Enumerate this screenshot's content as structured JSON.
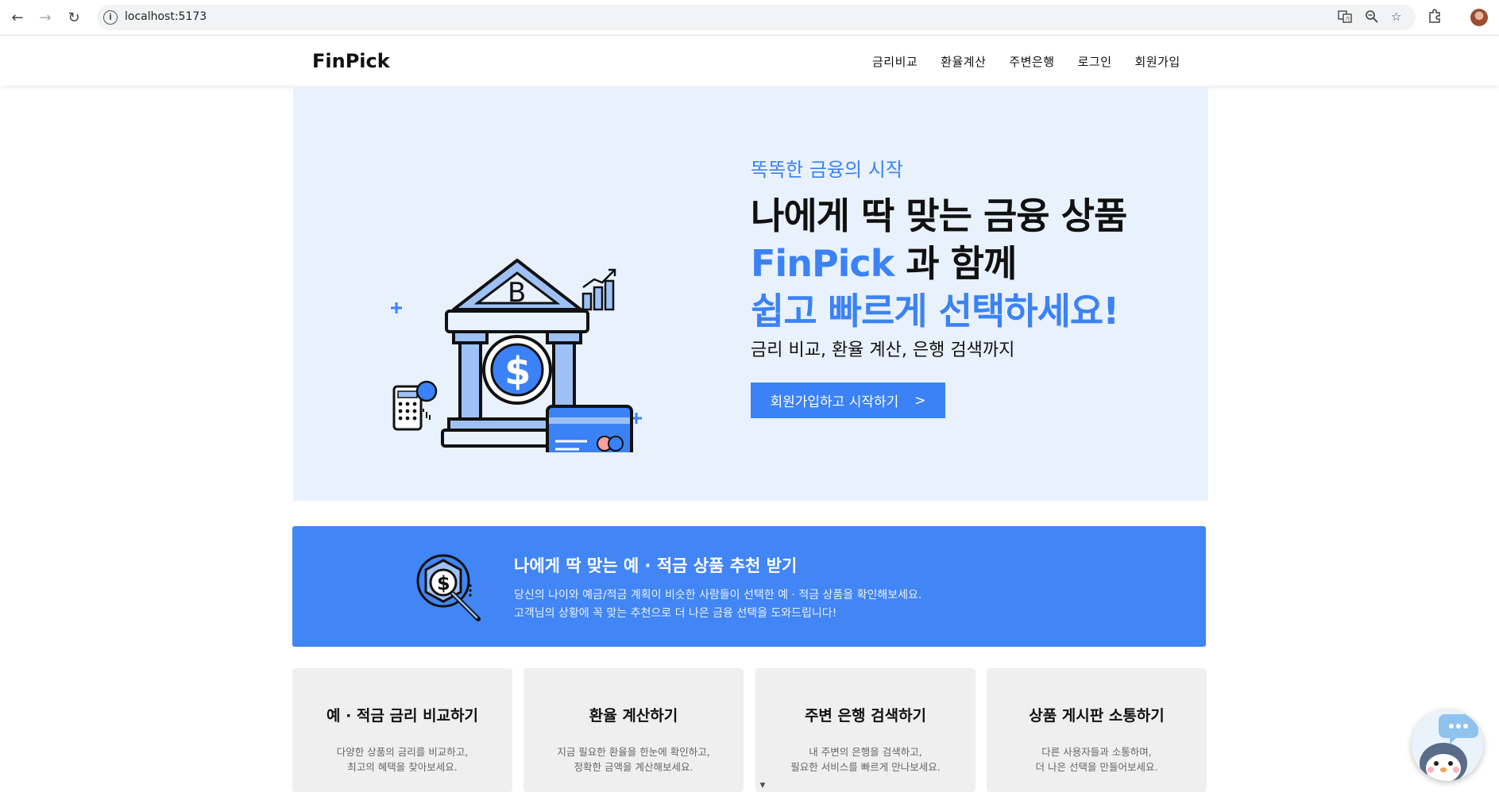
{
  "browser": {
    "url": "localhost:5173"
  },
  "header": {
    "logo": "FinPick",
    "menu": [
      {
        "label": "금리비교"
      },
      {
        "label": "환율계산"
      },
      {
        "label": "주변은행"
      },
      {
        "label": "로그인"
      },
      {
        "label": "회원가입"
      }
    ]
  },
  "hero": {
    "subtitle": "똑똑한 금융의 시작",
    "line1": "나에게 딱 맞는 금융 상품",
    "line2_brand": "FinPick",
    "line2_rest": "과 함께",
    "line3": "쉽고 빠르게 선택하세요!",
    "description": "금리 비교, 환율 계산, 은행 검색까지",
    "cta_label": "회원가입하고 시작하기",
    "cta_arrow": ">",
    "illustration_bank_letter": "B",
    "illustration_currency": "$"
  },
  "banner": {
    "title": "나에게 딱 맞는 예 · 적금 상품 추천 받기",
    "desc1": "당신의 나이와 예금/적금 계획이 비슷한 사람들이 선택한 예 · 적금 상품을 확인해보세요.",
    "desc2": "고객님의 상황에 꼭 맞는 추천으로 더 나은 금융 선택을 도와드립니다!",
    "icon_symbol": "$"
  },
  "cards": [
    {
      "title": "예 · 적금 금리 비교하기",
      "d1": "다양한 상품의 금리를 비교하고,",
      "d2": "최고의 혜택을 찾아보세요."
    },
    {
      "title": "환율 계산하기",
      "d1": "지금 필요한 환율을 한눈에 확인하고,",
      "d2": "정확한 금액을 계산해보세요."
    },
    {
      "title": "주변 은행 검색하기",
      "d1": "내 주변의 은행을 검색하고,",
      "d2": "필요한 서비스를 빠르게 만나보세요."
    },
    {
      "title": "상품 게시판 소통하기",
      "d1": "다른 사용자들과 소통하며,",
      "d2": "더 나은 선택을 만들어보세요."
    }
  ],
  "colors": {
    "accent": "#3b82f6",
    "banner": "#4285f4",
    "hero_bg": "#e9f1fd",
    "card_bg": "#efefef"
  }
}
